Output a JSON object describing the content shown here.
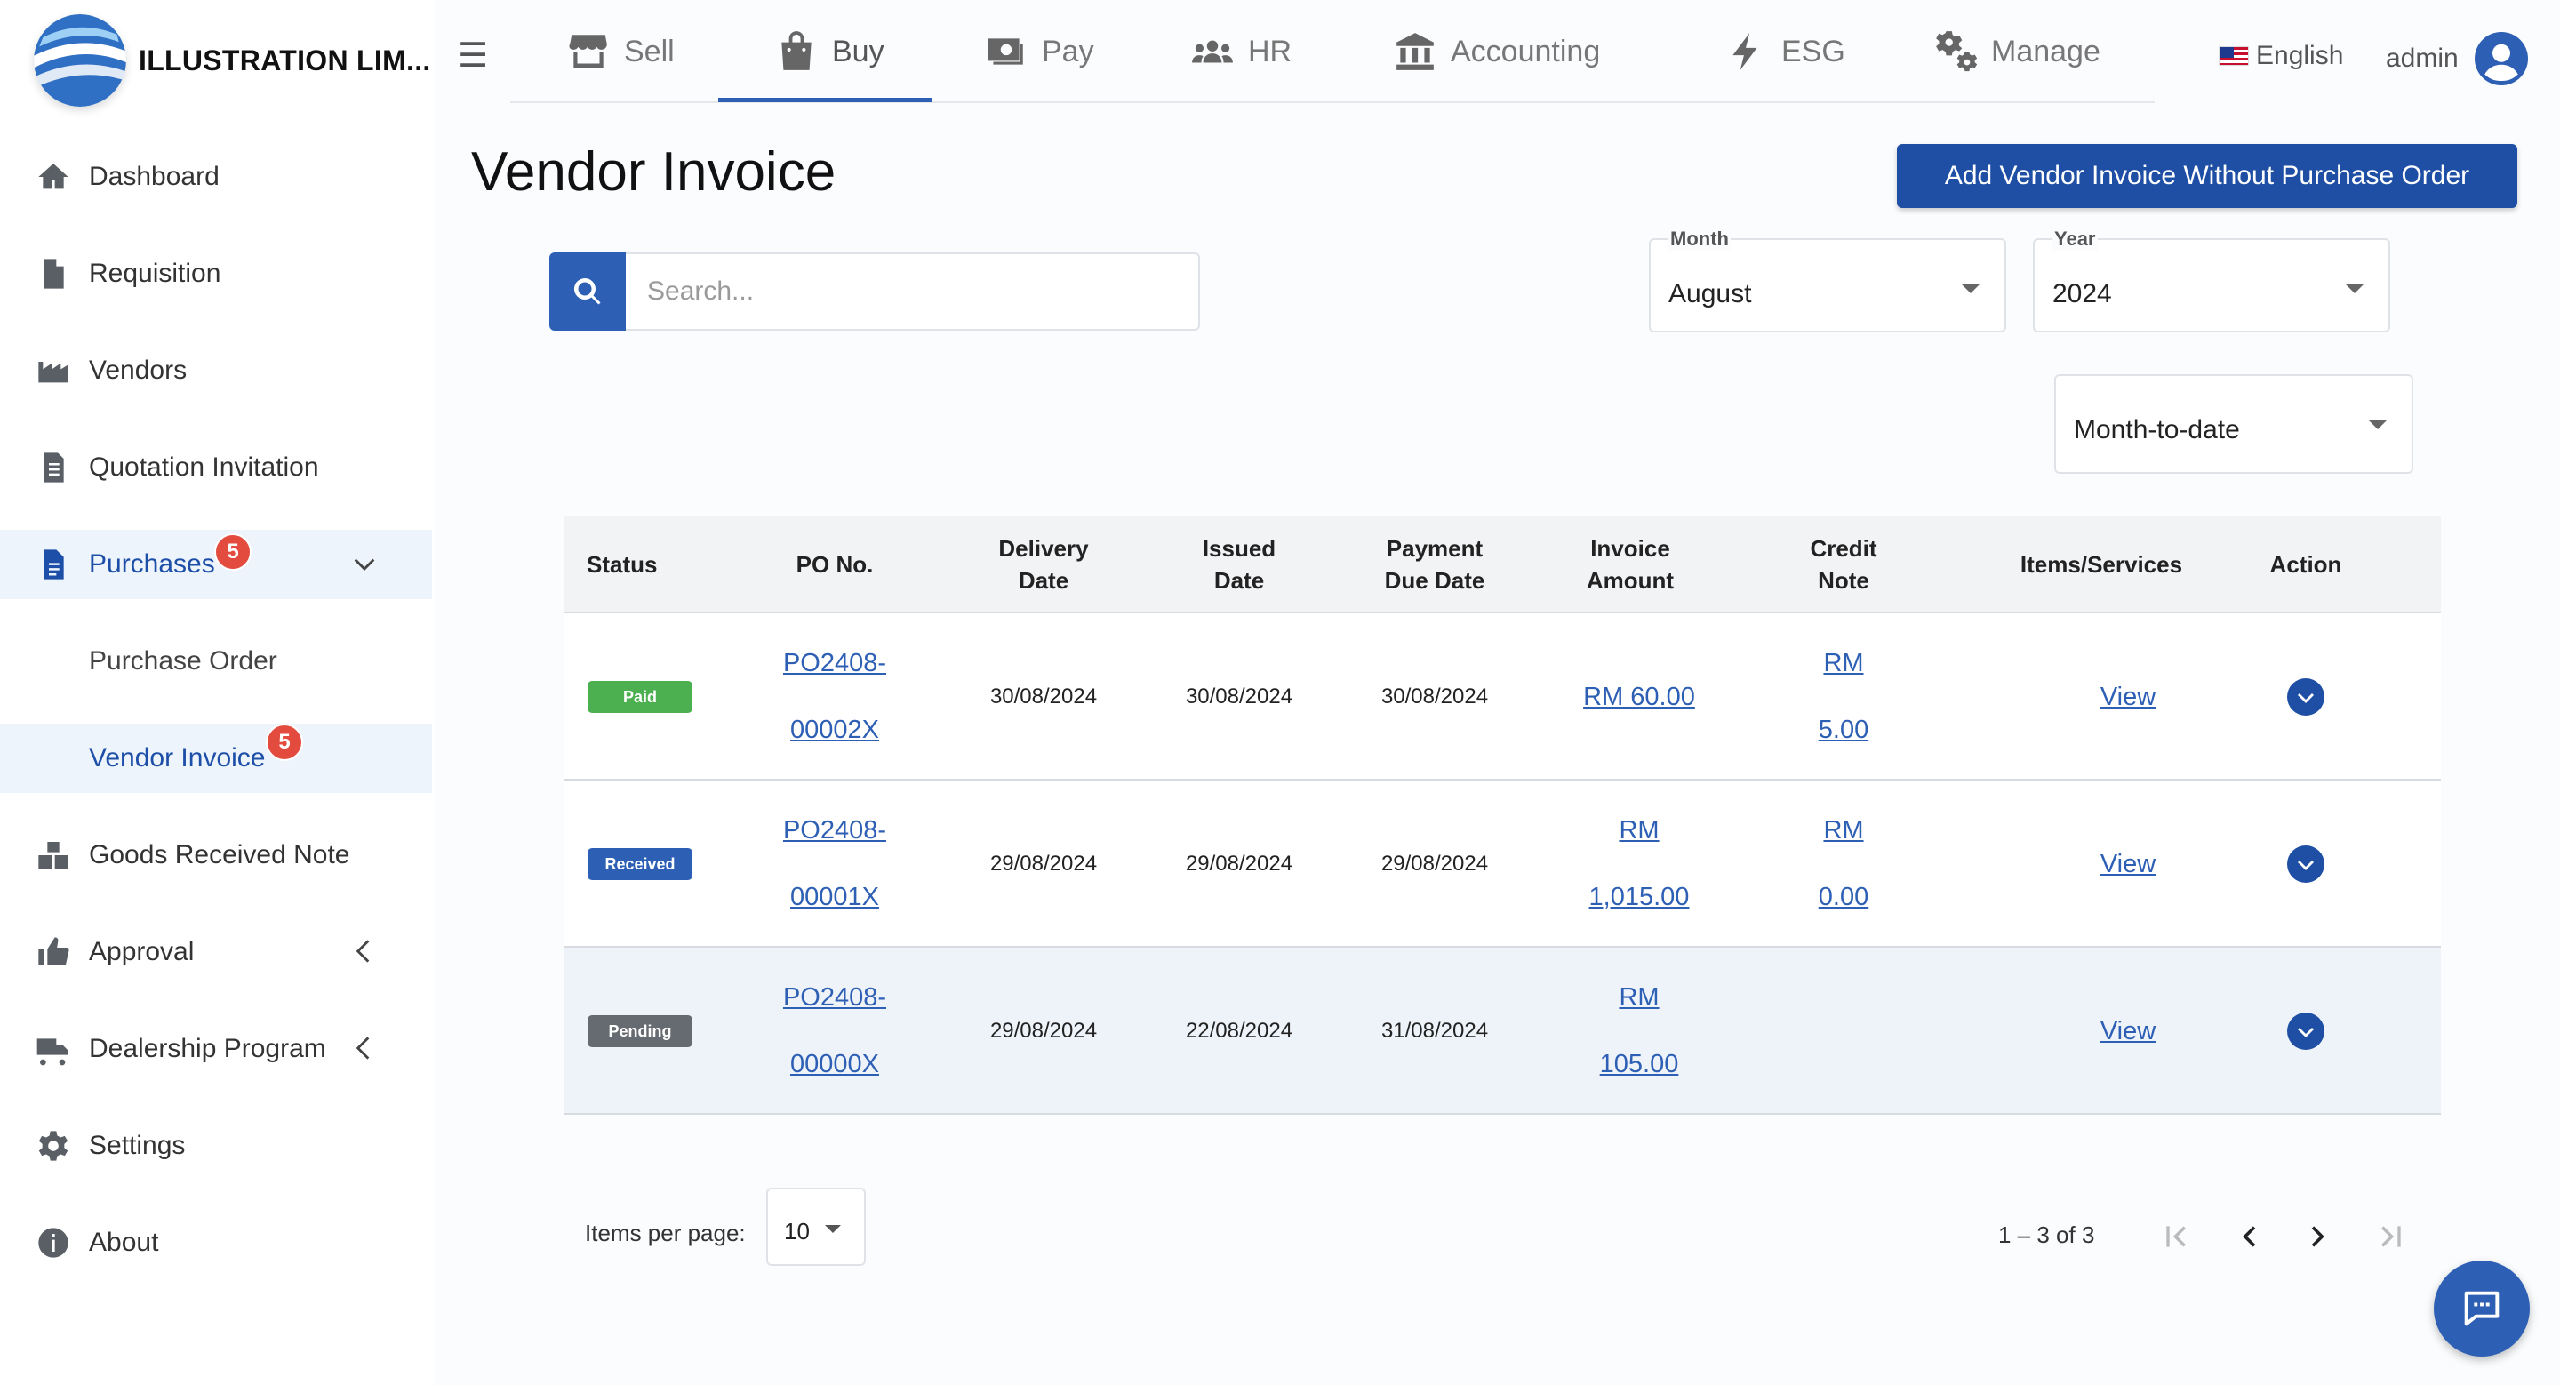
{
  "brand": {
    "name": "ILLUSTRATION LIM..."
  },
  "topnav": {
    "tabs": [
      {
        "label": "Sell",
        "icon": "store-icon"
      },
      {
        "label": "Buy",
        "icon": "shopping-bag-icon"
      },
      {
        "label": "Pay",
        "icon": "cash-icon"
      },
      {
        "label": "HR",
        "icon": "people-icon"
      },
      {
        "label": "Accounting",
        "icon": "bank-icon"
      },
      {
        "label": "ESG",
        "icon": "bolt-icon"
      },
      {
        "label": "Manage",
        "icon": "gears-icon"
      }
    ],
    "active_tab": "Buy",
    "language": "English",
    "user": "admin"
  },
  "sidebar": {
    "items": [
      {
        "label": "Dashboard",
        "icon": "home-icon"
      },
      {
        "label": "Requisition",
        "icon": "file-icon"
      },
      {
        "label": "Vendors",
        "icon": "factory-icon"
      },
      {
        "label": "Quotation Invitation",
        "icon": "document-icon"
      },
      {
        "label": "Purchases",
        "icon": "file-text-icon",
        "badge": "5",
        "expanded": true
      },
      {
        "label": "Purchase Order"
      },
      {
        "label": "Vendor Invoice",
        "badge": "5",
        "active": true
      },
      {
        "label": "Goods Received Note",
        "icon": "boxes-icon"
      },
      {
        "label": "Approval",
        "icon": "thumbs-up-icon"
      },
      {
        "label": "Dealership Program",
        "icon": "truck-icon"
      },
      {
        "label": "Settings",
        "icon": "gear-icon"
      },
      {
        "label": "About",
        "icon": "info-icon"
      }
    ]
  },
  "page": {
    "title": "Vendor Invoice",
    "add_button": "Add Vendor Invoice Without Purchase Order"
  },
  "search": {
    "placeholder": "Search...",
    "value": ""
  },
  "filters": {
    "month": {
      "label": "Month",
      "value": "August"
    },
    "year": {
      "label": "Year",
      "value": "2024"
    },
    "period": {
      "value": "Month-to-date"
    }
  },
  "table": {
    "headers": {
      "status": "Status",
      "po_no": "PO No.",
      "delivery_1": "Delivery",
      "delivery_2": "Date",
      "issued_1": "Issued",
      "issued_2": "Date",
      "payment_1": "Payment",
      "payment_2": "Due Date",
      "invoice_1": "Invoice",
      "invoice_2": "Amount",
      "credit_1": "Credit",
      "credit_2": "Note",
      "items": "Items/Services",
      "action": "Action"
    },
    "rows": [
      {
        "status": "Paid",
        "status_color": "#4caf50",
        "po_1": "PO2408-",
        "po_2": "00002X",
        "delivery": "30/08/2024",
        "issued": "30/08/2024",
        "payment_due": "30/08/2024",
        "invoice_1": "RM 60.00",
        "invoice_2": "",
        "credit_1": "RM",
        "credit_2": "5.00",
        "items": "View"
      },
      {
        "status": "Received",
        "status_color": "#2d5fb5",
        "po_1": "PO2408-",
        "po_2": "00001X",
        "delivery": "29/08/2024",
        "issued": "29/08/2024",
        "payment_due": "29/08/2024",
        "invoice_1": "RM",
        "invoice_2": "1,015.00",
        "credit_1": "RM",
        "credit_2": "0.00",
        "items": "View"
      },
      {
        "status": "Pending",
        "status_color": "#666b72",
        "po_1": "PO2408-",
        "po_2": "00000X",
        "delivery": "29/08/2024",
        "issued": "22/08/2024",
        "payment_due": "31/08/2024",
        "invoice_1": "RM",
        "invoice_2": "105.00",
        "credit_1": "",
        "credit_2": "",
        "items": "View"
      }
    ]
  },
  "paginator": {
    "label": "Items per page:",
    "page_size": "10",
    "range": "1 – 3 of 3"
  },
  "colors": {
    "primary": "#1f4fa5",
    "accent": "#2d5fb5",
    "badge": "#e34b3e"
  }
}
